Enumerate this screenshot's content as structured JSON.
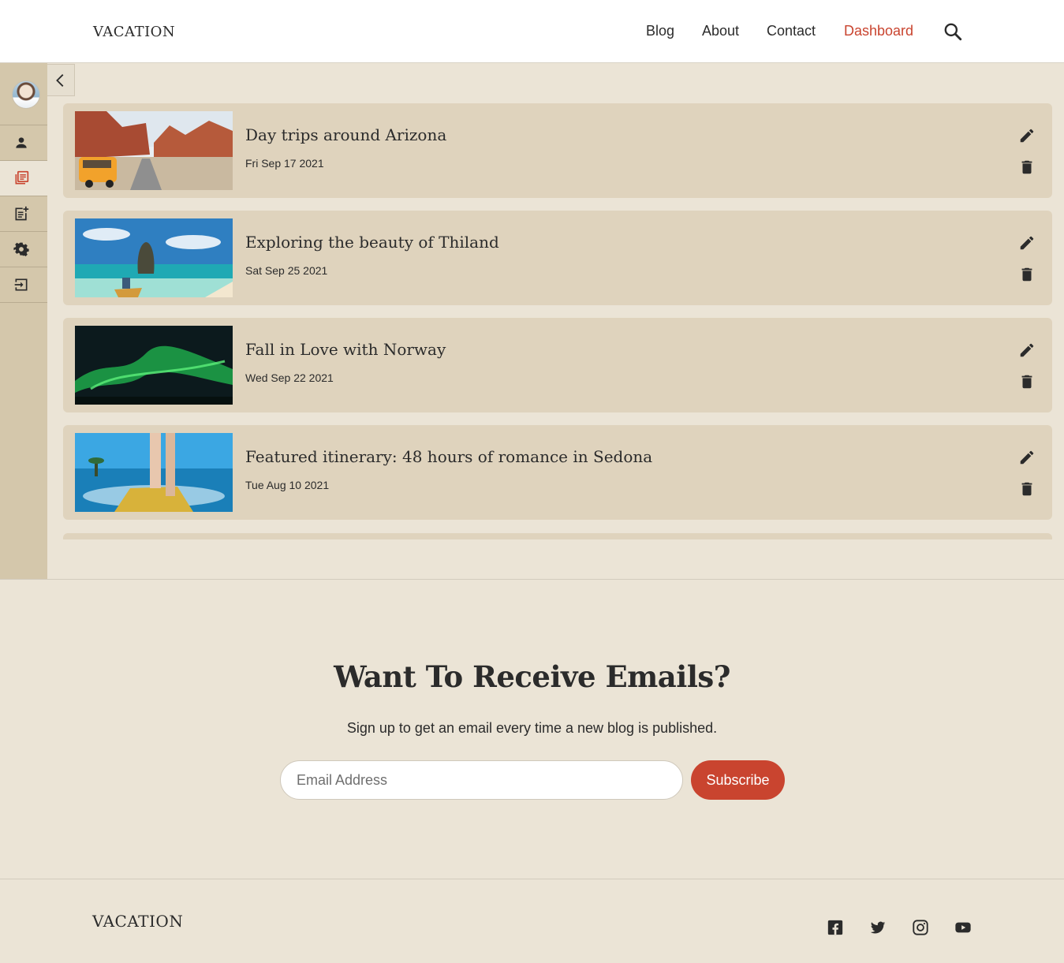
{
  "header": {
    "logo": "VACATION",
    "nav": [
      {
        "label": "Blog"
      },
      {
        "label": "About"
      },
      {
        "label": "Contact"
      },
      {
        "label": "Dashboard",
        "active": true
      }
    ],
    "accent_color": "#c9442f"
  },
  "sidebar": {
    "items": [
      {
        "icon": "person-icon",
        "label": "Profile"
      },
      {
        "icon": "posts-list-icon",
        "label": "Posts",
        "active": true
      },
      {
        "icon": "new-post-icon",
        "label": "New post"
      },
      {
        "icon": "gear-icon",
        "label": "Settings"
      },
      {
        "icon": "logout-icon",
        "label": "Logout"
      }
    ]
  },
  "posts": [
    {
      "title": "Day trips around Arizona",
      "date": "Fri Sep 17 2021"
    },
    {
      "title": "Exploring the beauty of Thiland",
      "date": "Sat Sep 25 2021"
    },
    {
      "title": "Fall in Love with Norway",
      "date": "Wed Sep 22 2021"
    },
    {
      "title": "Featured itinerary: 48 hours of romance in Sedona",
      "date": "Tue Aug 10 2021"
    }
  ],
  "newsletter": {
    "heading": "Want To Receive Emails?",
    "subtext": "Sign up to get an email every time a new blog is published.",
    "email_placeholder": "Email Address",
    "subscribe_label": "Subscribe"
  },
  "footer": {
    "logo": "VACATION",
    "social": [
      "facebook-icon",
      "twitter-icon",
      "instagram-icon",
      "youtube-icon"
    ]
  }
}
